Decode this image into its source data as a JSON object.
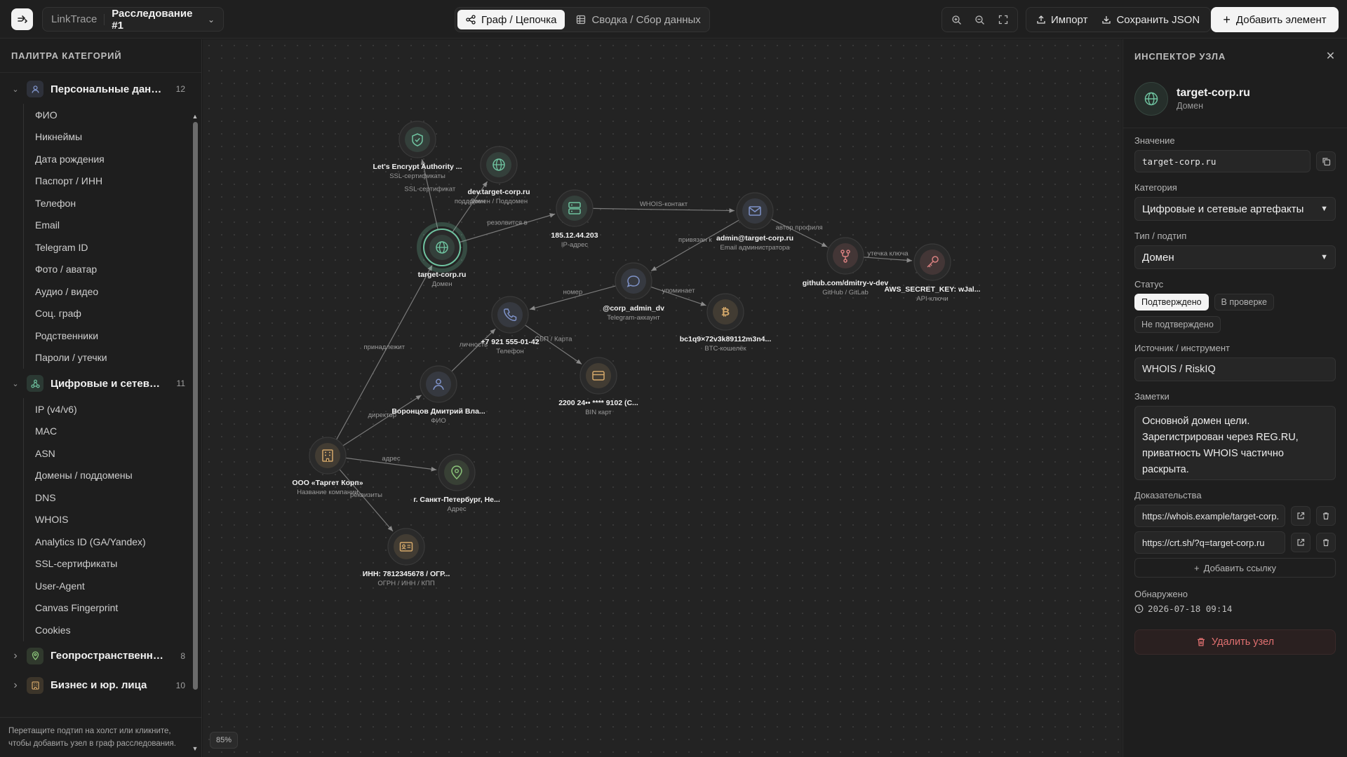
{
  "header": {
    "app_name": "LinkTrace",
    "case_name": "Расследование #1",
    "tabs": [
      {
        "label": "Граф / Цепочка",
        "active": true
      },
      {
        "label": "Сводка / Сбор данных",
        "active": false
      }
    ],
    "import_label": "Импорт",
    "save_label": "Сохранить JSON",
    "add_label": "Добавить элемент"
  },
  "sidebar": {
    "title": "ПАЛИТРА КАТЕГОРИЙ",
    "categories": [
      {
        "label": "Персональные данные",
        "count": "12",
        "expanded": true,
        "color": "#7f93c9",
        "icon": "user-icon",
        "items": [
          "ФИО",
          "Никнеймы",
          "Дата рождения",
          "Паспорт / ИНН",
          "Телефон",
          "Email",
          "Telegram ID",
          "Фото / аватар",
          "Аудио / видео",
          "Соц. граф",
          "Родственники",
          "Пароли / утечки"
        ]
      },
      {
        "label": "Цифровые и сетевые...",
        "count": "11",
        "expanded": true,
        "color": "#6fc3a0",
        "icon": "network-icon",
        "items": [
          "IP (v4/v6)",
          "MAC",
          "ASN",
          "Домены / поддомены",
          "DNS",
          "WHOIS",
          "Analytics ID (GA/Yandex)",
          "SSL-сертификаты",
          "User-Agent",
          "Canvas Fingerprint",
          "Cookies"
        ]
      },
      {
        "label": "Геопространственны...",
        "count": "8",
        "expanded": false,
        "color": "#8bc47a",
        "icon": "location-icon",
        "items": []
      },
      {
        "label": "Бизнес и юр. лица",
        "count": "10",
        "expanded": false,
        "color": "#d4a86a",
        "icon": "building-icon",
        "items": []
      }
    ],
    "hint": "Перетащите подтип на холст или кликните, чтобы добавить узел в граф расследования."
  },
  "canvas": {
    "zoom": "85%",
    "nodes": [
      {
        "id": "ssl",
        "title": "Let's Encrypt Authority ...",
        "subtitle": "SSL-сертификаты",
        "color": "#6fc3a0",
        "icon": "shield-icon"
      },
      {
        "id": "dev",
        "title": "dev.target-corp.ru",
        "subtitle": "Домен / Поддомен",
        "color": "#6fc3a0",
        "icon": "globe-icon"
      },
      {
        "id": "target",
        "title": "target-corp.ru",
        "subtitle": "Домен",
        "color": "#6fc3a0",
        "icon": "globe-icon",
        "selected": true
      },
      {
        "id": "ip",
        "title": "185.12.44.203",
        "subtitle": "IP-адрес",
        "color": "#6fc3a0",
        "icon": "server-icon"
      },
      {
        "id": "email",
        "title": "admin@target-corp.ru",
        "subtitle": "Email администратора",
        "color": "#7f93c9",
        "icon": "mail-icon"
      },
      {
        "id": "github",
        "title": "github.com/dmitry-v-dev",
        "subtitle": "GitHub / GitLab",
        "color": "#d98080",
        "icon": "fork-icon"
      },
      {
        "id": "aws",
        "title": "AWS_SECRET_KEY: wJal...",
        "subtitle": "API-ключи",
        "color": "#d98080",
        "icon": "key-icon"
      },
      {
        "id": "tg",
        "title": "@corp_admin_dv",
        "subtitle": "Telegram-аккаунт",
        "color": "#7f93c9",
        "icon": "chat-icon"
      },
      {
        "id": "btc",
        "title": "bc1q9×72v3k89112m3n4...",
        "subtitle": "BTC-кошелёк",
        "color": "#d4a86a",
        "icon": "bitcoin-icon"
      },
      {
        "id": "phone",
        "title": "+7 921 555-01-42",
        "subtitle": "Телефон",
        "color": "#7f93c9",
        "icon": "phone-icon"
      },
      {
        "id": "card",
        "title": "2200 24•• **** 9102 (С...",
        "subtitle": "BIN карт",
        "color": "#d4a86a",
        "icon": "card-icon"
      },
      {
        "id": "person",
        "title": "Воронцов Дмитрий Вла...",
        "subtitle": "ФИО",
        "color": "#7f93c9",
        "icon": "user-icon"
      },
      {
        "id": "company",
        "title": "ООО «Таргет Корп»",
        "subtitle": "Название компании",
        "color": "#d4a86a",
        "icon": "building-icon"
      },
      {
        "id": "addr",
        "title": "г. Санкт-Петербург, Не...",
        "subtitle": "Адрес",
        "color": "#8bc47a",
        "icon": "pin-icon"
      },
      {
        "id": "inn",
        "title": "ИНН: 7812345678 / ОГР...",
        "subtitle": "ОГРН / ИНН / КПП",
        "color": "#d4a86a",
        "icon": "id-card-icon"
      }
    ],
    "edges": [
      {
        "from": "target",
        "to": "ssl",
        "label": "SSL-сертификат"
      },
      {
        "from": "target",
        "to": "dev",
        "label": "поддомен"
      },
      {
        "from": "target",
        "to": "ip",
        "label": "резолвится в"
      },
      {
        "from": "ip",
        "to": "email",
        "label": "WHOIS-контакт"
      },
      {
        "from": "email",
        "to": "github",
        "label": "автор профиля"
      },
      {
        "from": "github",
        "to": "aws",
        "label": "утечка ключа"
      },
      {
        "from": "email",
        "to": "tg",
        "label": "привязан к"
      },
      {
        "from": "tg",
        "to": "phone",
        "label": "номер"
      },
      {
        "from": "tg",
        "to": "btc",
        "label": "упоминает"
      },
      {
        "from": "phone",
        "to": "card",
        "label": "СБП / Карта"
      },
      {
        "from": "person",
        "to": "phone",
        "label": "личность"
      },
      {
        "from": "company",
        "to": "target",
        "label": "принадлежит"
      },
      {
        "from": "company",
        "to": "person",
        "label": "директор"
      },
      {
        "from": "company",
        "to": "addr",
        "label": "адрес"
      },
      {
        "from": "company",
        "to": "inn",
        "label": "реквизиты"
      }
    ]
  },
  "inspector": {
    "title": "ИНСПЕКТОР УЗЛА",
    "node_title": "target-corp.ru",
    "node_subtitle": "Домен",
    "value_label": "Значение",
    "value": "target-corp.ru",
    "category_label": "Категория",
    "category": "Цифровые и сетевые артефакты",
    "type_label": "Тип / подтип",
    "type": "Домен",
    "status_label": "Статус",
    "statuses": [
      {
        "label": "Подтверждено",
        "active": true
      },
      {
        "label": "В проверке",
        "active": false
      },
      {
        "label": "Не подтверждено",
        "active": false
      }
    ],
    "source_label": "Источник / инструмент",
    "source": "WHOIS / RiskIQ",
    "notes_label": "Заметки",
    "notes": "Основной домен цели. Зарегистрирован через REG.RU, приватность WHOIS частично раскрыта.",
    "evidence_label": "Доказательства",
    "evidence": [
      "https://whois.example/target-corp.",
      "https://crt.sh/?q=target-corp.ru"
    ],
    "add_link_label": "Добавить ссылку",
    "found_label": "Обнаружено",
    "found_at": "2026-07-18 09:14",
    "delete_label": "Удалить узел"
  }
}
